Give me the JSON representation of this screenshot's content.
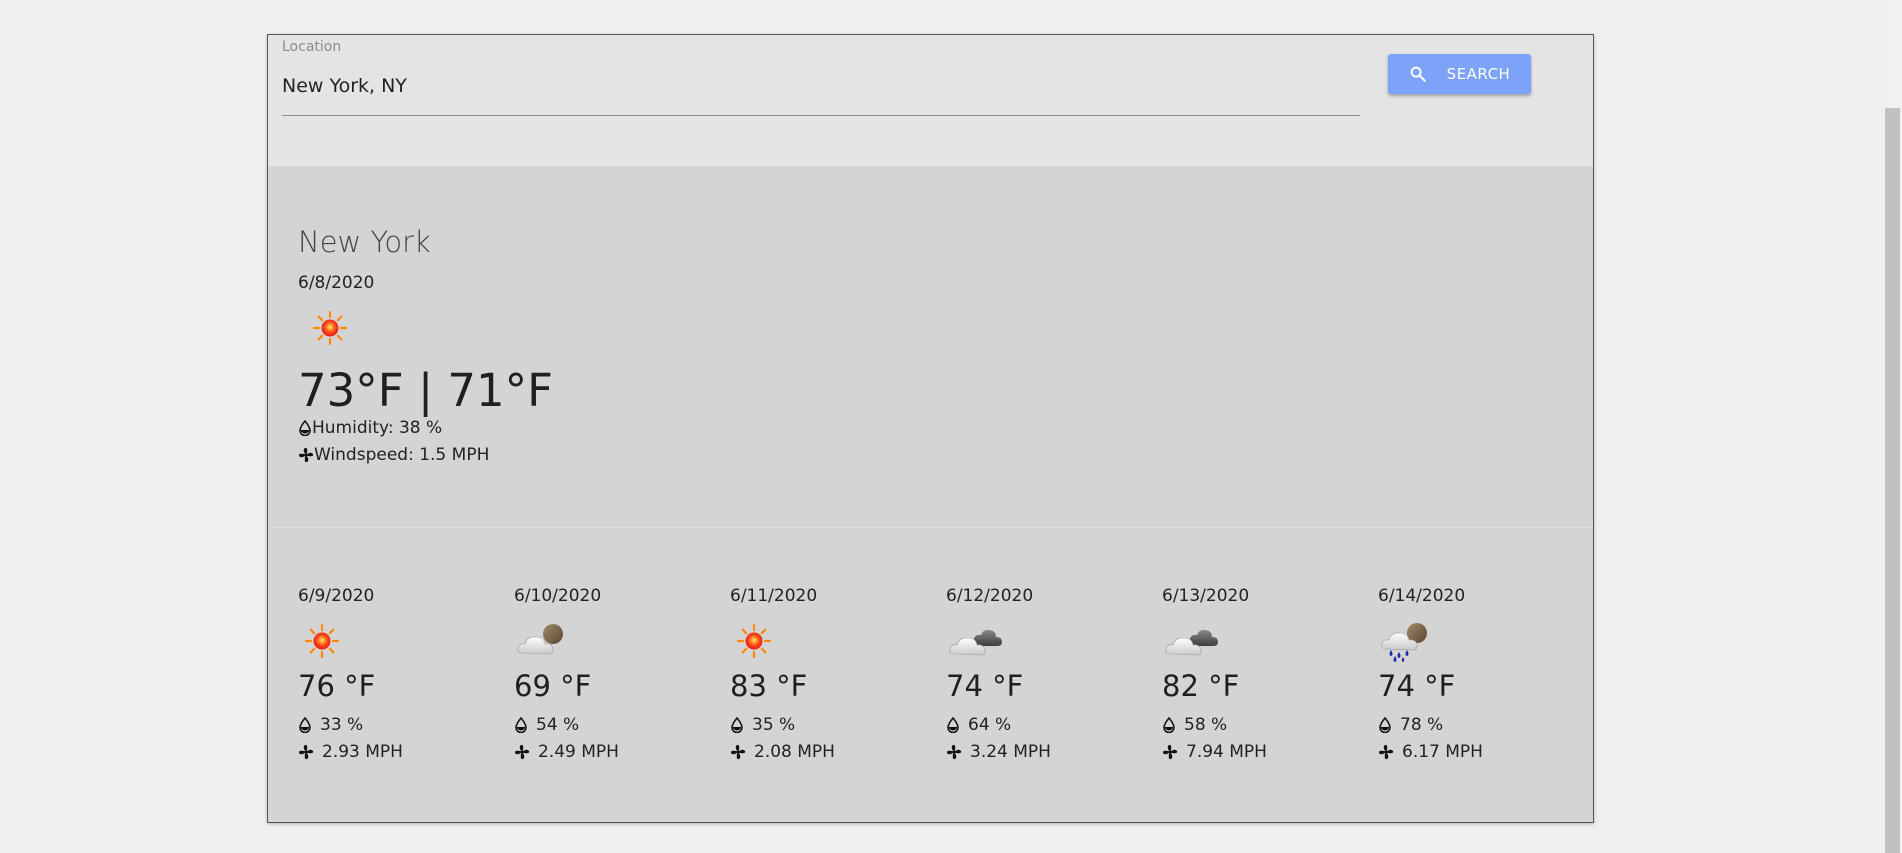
{
  "search": {
    "label": "Location",
    "value": "New York, NY",
    "button_label": "SEARCH"
  },
  "current": {
    "city": "New York",
    "date": "6/8/2020",
    "icon": "sun-icon",
    "temps": "73°F | 71°F",
    "humidity": "Humidity: 38 %",
    "windspeed": "Windspeed: 1.5 MPH"
  },
  "forecast": [
    {
      "date": "6/9/2020",
      "icon": "sun-icon",
      "temp": "76 °F",
      "humidity": "33 %",
      "wind": "2.93 MPH"
    },
    {
      "date": "6/10/2020",
      "icon": "partly-cloudy-icon",
      "temp": "69 °F",
      "humidity": "54 %",
      "wind": "2.49 MPH"
    },
    {
      "date": "6/11/2020",
      "icon": "sun-icon",
      "temp": "83 °F",
      "humidity": "35 %",
      "wind": "2.08 MPH"
    },
    {
      "date": "6/12/2020",
      "icon": "cloudy-icon",
      "temp": "74 °F",
      "humidity": "64 %",
      "wind": "3.24 MPH"
    },
    {
      "date": "6/13/2020",
      "icon": "cloudy-icon",
      "temp": "82 °F",
      "humidity": "58 %",
      "wind": "7.94 MPH"
    },
    {
      "date": "6/14/2020",
      "icon": "rain-icon",
      "temp": "74 °F",
      "humidity": "78 %",
      "wind": "6.17 MPH"
    }
  ],
  "colors": {
    "button": "#7ca3f7",
    "card": "#d4d4d4",
    "header": "#e4e4e4"
  }
}
